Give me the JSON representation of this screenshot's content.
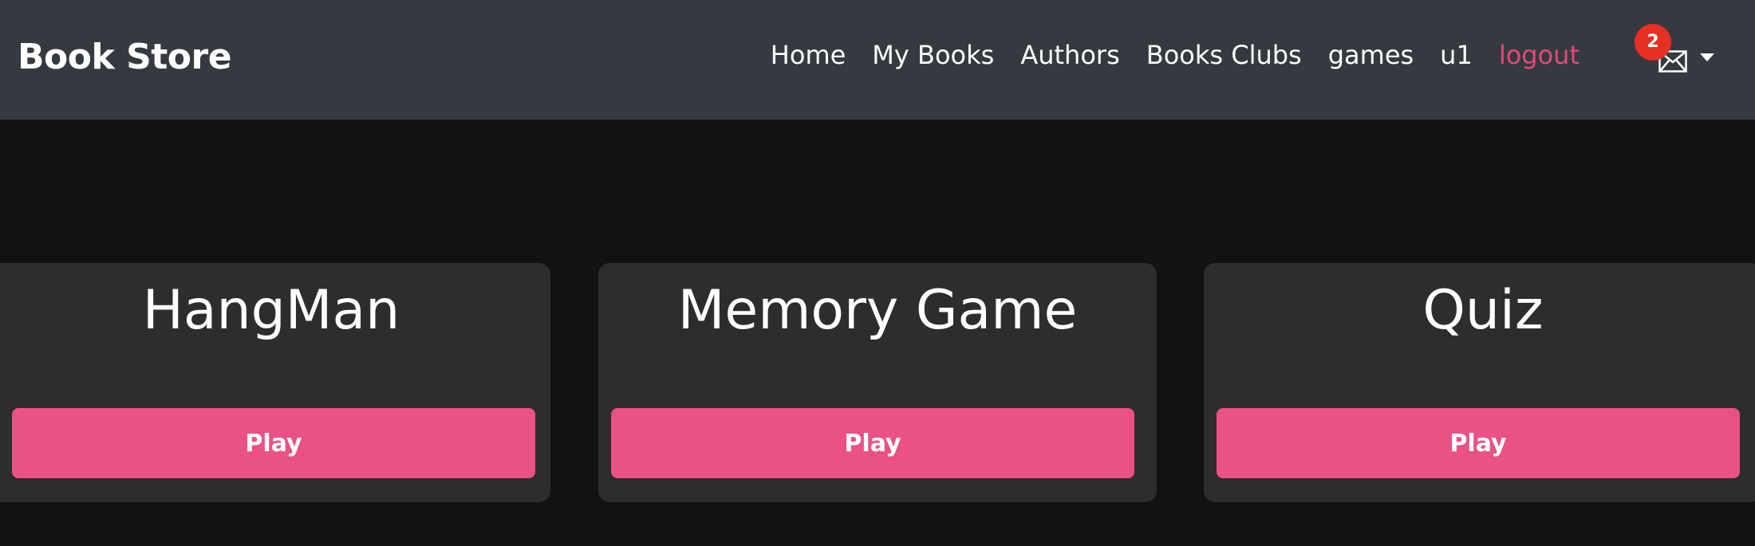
{
  "navbar": {
    "brand": "Book Store",
    "links": [
      "Home",
      "My Books",
      "Authors",
      "Books Clubs",
      "games",
      "u1",
      "logout"
    ],
    "mail": {
      "icon": "envelope-icon",
      "badge_count": "2"
    },
    "colors": {
      "background": "#343a40",
      "logout": "#e8467c",
      "badge": "#e53023"
    }
  },
  "games": [
    {
      "title": "HangMan",
      "button": "Play"
    },
    {
      "title": "Memory Game",
      "button": "Play"
    },
    {
      "title": "Quiz",
      "button": "Play"
    }
  ],
  "colors": {
    "page_bg": "#121212",
    "card_bg": "#2d2d2d",
    "accent": "#e95282"
  }
}
